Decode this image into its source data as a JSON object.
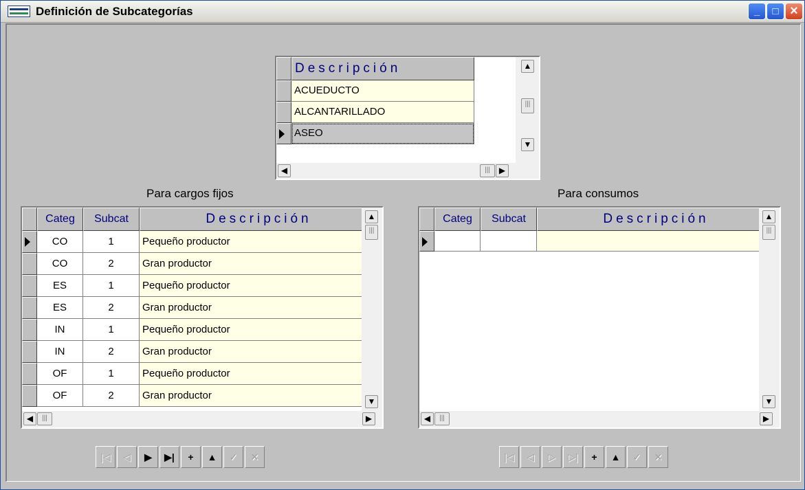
{
  "window": {
    "title": "Definición de Subcategorías",
    "controls": [
      "_",
      "□",
      "×"
    ]
  },
  "top_grid": {
    "header": "Descripción",
    "rows": [
      "ACUEDUCTO",
      "ALCANTARILLADO",
      "ASEO"
    ],
    "selected_index": 2
  },
  "left_panel": {
    "label": "Para cargos fijos",
    "headers": {
      "categ": "Categ",
      "subcat": "Subcat",
      "desc": "Descripción"
    },
    "rows": [
      {
        "categ": "CO",
        "subcat": "1",
        "desc": "Pequeño productor"
      },
      {
        "categ": "CO",
        "subcat": "2",
        "desc": "Gran productor"
      },
      {
        "categ": "ES",
        "subcat": "1",
        "desc": "Pequeño productor"
      },
      {
        "categ": "ES",
        "subcat": "2",
        "desc": "Gran productor"
      },
      {
        "categ": "IN",
        "subcat": "1",
        "desc": "Pequeño productor"
      },
      {
        "categ": "IN",
        "subcat": "2",
        "desc": "Gran productor"
      },
      {
        "categ": "OF",
        "subcat": "1",
        "desc": "Pequeño productor"
      },
      {
        "categ": "OF",
        "subcat": "2",
        "desc": "Gran productor"
      }
    ]
  },
  "right_panel": {
    "label": "Para consumos",
    "headers": {
      "categ": "Categ",
      "subcat": "Subcat",
      "desc": "Descripción"
    },
    "rows": []
  },
  "left_nav": [
    "|◁",
    "◁",
    "▶",
    "▶|",
    "+",
    "▲",
    "✓",
    "✕"
  ],
  "right_nav": [
    "|◁",
    "◁",
    "▷",
    "▷|",
    "+",
    "▲",
    "✓",
    "✕"
  ],
  "icons": {
    "scroll_up": "▲",
    "scroll_down": "▼",
    "scroll_left": "◀",
    "scroll_right": "▶",
    "thumb": "|||"
  }
}
